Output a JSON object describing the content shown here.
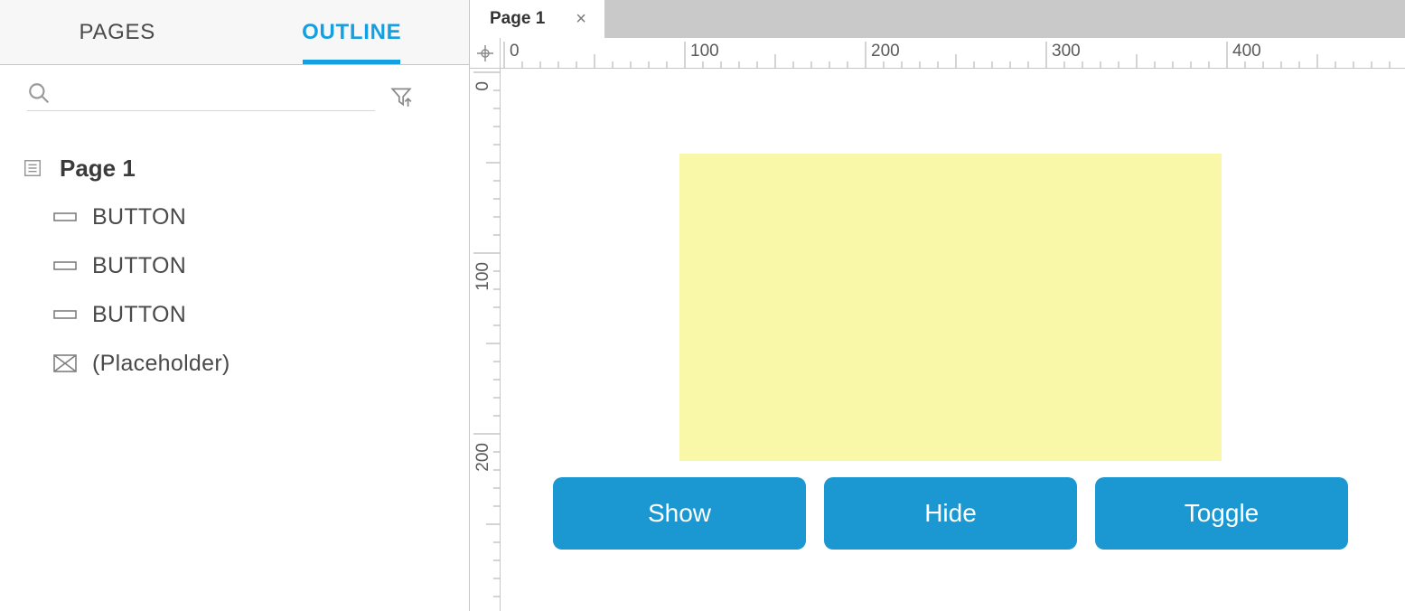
{
  "sidebar": {
    "tabs": {
      "pages": "PAGES",
      "outline": "OUTLINE"
    },
    "search_placeholder": "",
    "tree": {
      "page_label": "Page 1",
      "items": [
        {
          "label": "BUTTON",
          "kind": "button"
        },
        {
          "label": "BUTTON",
          "kind": "button"
        },
        {
          "label": "BUTTON",
          "kind": "button"
        },
        {
          "label": "(Placeholder)",
          "kind": "placeholder"
        }
      ]
    }
  },
  "tabstrip": {
    "tab_label": "Page 1"
  },
  "ruler": {
    "h_marks": [
      0,
      100,
      200,
      300,
      400
    ],
    "v_marks": [
      0,
      100,
      200
    ]
  },
  "canvas": {
    "placeholder_color": "#f9f8a8",
    "buttons": {
      "show": "Show",
      "hide": "Hide",
      "toggle": "Toggle"
    }
  }
}
